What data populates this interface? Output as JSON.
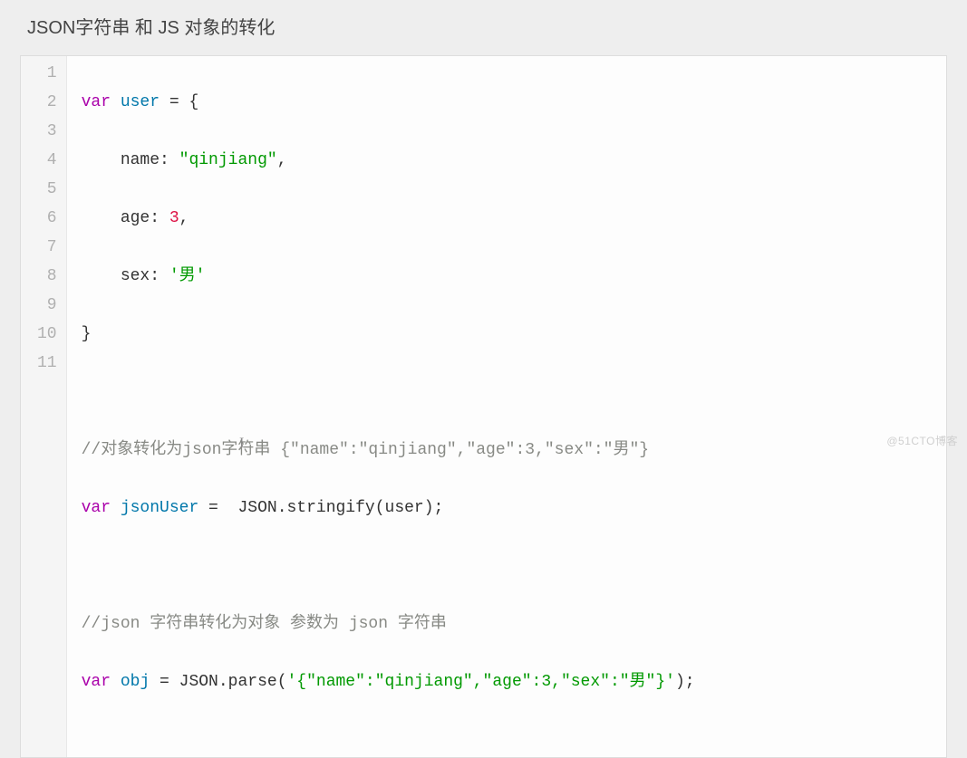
{
  "heading": "JSON字符串 和 JS 对象的转化",
  "lineNumbers": [
    "1",
    "2",
    "3",
    "4",
    "5",
    "6",
    "7",
    "8",
    "9",
    "10",
    "11"
  ],
  "code": {
    "l1": {
      "kw": "var",
      "var": "user",
      "rest": " = {"
    },
    "l2": {
      "indent": "    ",
      "prop": "name",
      "colon": ": ",
      "str": "\"qinjiang\"",
      "comma": ","
    },
    "l3": {
      "indent": "    ",
      "prop": "age",
      "colon": ": ",
      "num": "3",
      "comma": ","
    },
    "l4": {
      "indent": "    ",
      "prop": "sex",
      "colon": ": ",
      "str": "'男'"
    },
    "l5": {
      "brace": "}"
    },
    "l6": {
      "blank": ""
    },
    "l7": {
      "cmt": "//对象转化为json字符串 {\"name\":\"qinjiang\",\"age\":3,\"sex\":\"男\"}"
    },
    "l8": {
      "kw": "var",
      "var": "jsonUser",
      "eq": " =  ",
      "obj": "JSON",
      "dot": ".",
      "fn": "stringify",
      "open": "(",
      "arg": "user",
      "close": ");"
    },
    "l9": {
      "blank": ""
    },
    "l10": {
      "cmt": "//json 字符串转化为对象 参数为 json 字符串"
    },
    "l11": {
      "kw": "var",
      "var": "obj",
      "eq": " = ",
      "obj": "JSON",
      "dot": ".",
      "fn": "parse",
      "open": "(",
      "str": "'{\"name\":\"qinjiang\",\"age\":3,\"sex\":\"男\"}'",
      "close": ");"
    }
  },
  "watermark": "@51CTO博客",
  "cursor": "I"
}
